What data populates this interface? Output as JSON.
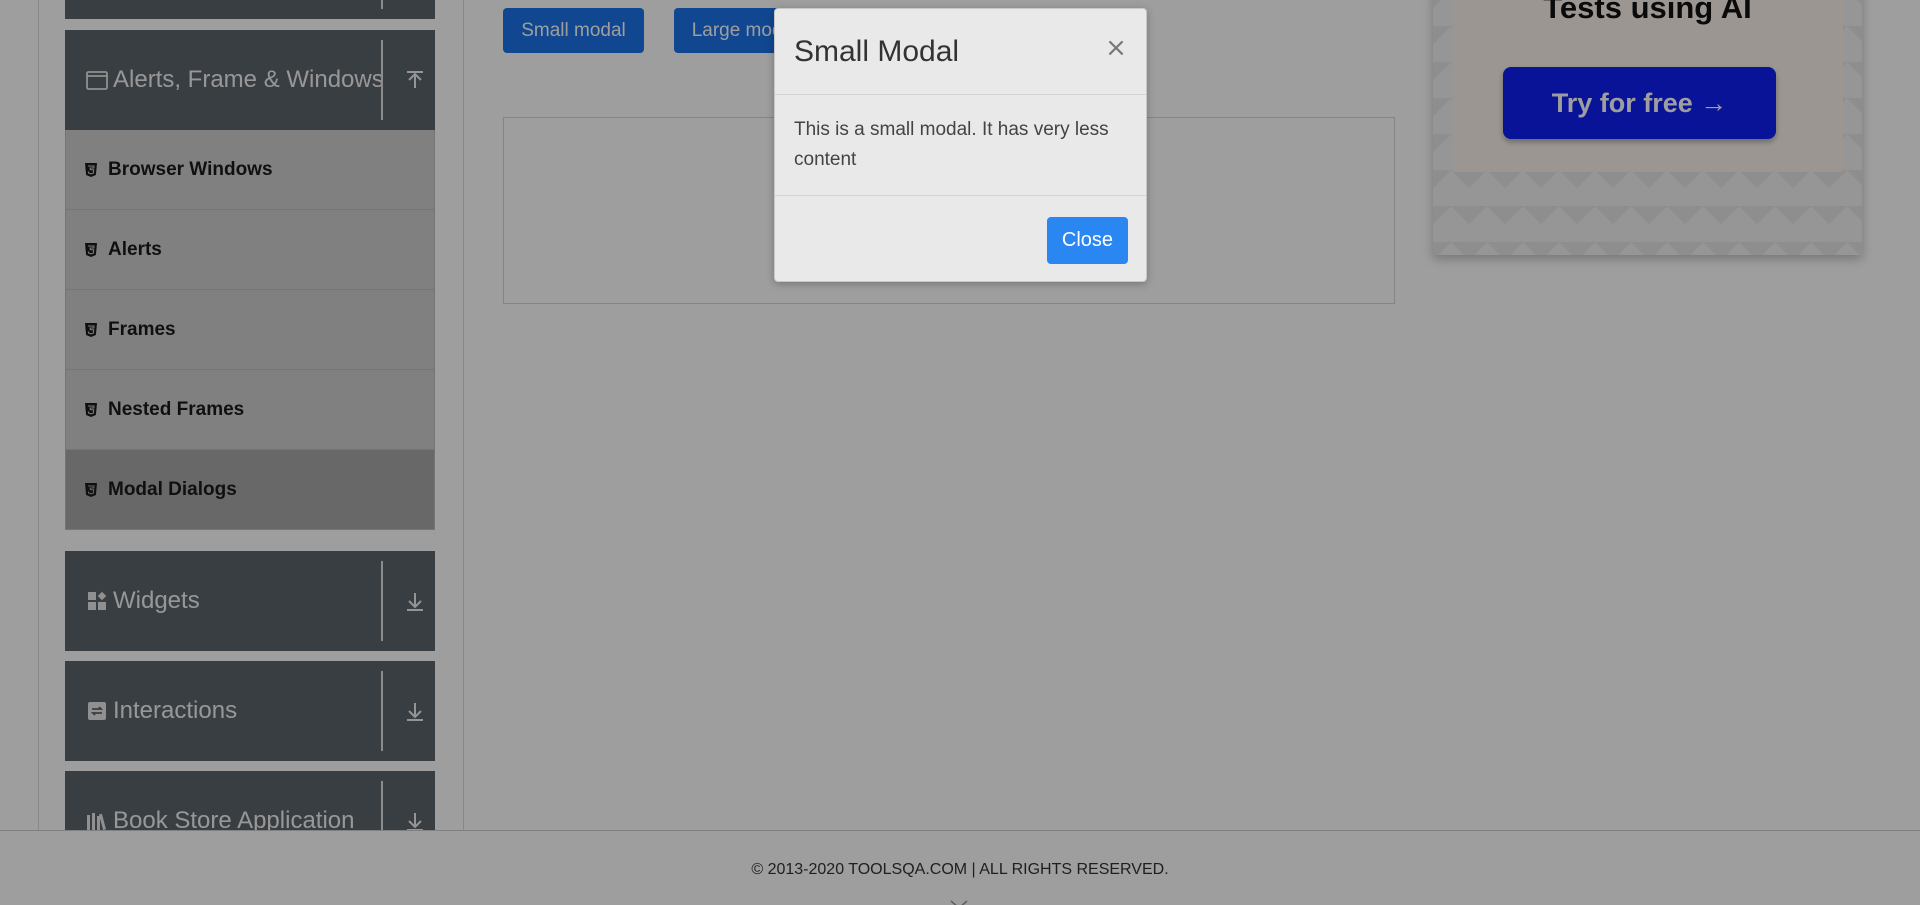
{
  "colors": {
    "primary": "#1a73e8",
    "sidebar_header": "#5c646d",
    "menu_item": "#cfcfcf",
    "menu_item_active": "#a9a9a9",
    "ad_cta": "#0f1ff5",
    "overlay": "rgba(0,0,0,0.38)"
  },
  "sidebar": {
    "groups": [
      {
        "label": "Alerts, Frame & Windows",
        "icon": "window-icon",
        "expanded": true
      },
      {
        "label": "Widgets",
        "icon": "widgets-icon",
        "expanded": false
      },
      {
        "label": "Interactions",
        "icon": "interactions-icon",
        "expanded": false
      },
      {
        "label": "Book Store Application",
        "icon": "book-store-icon",
        "expanded": false
      }
    ],
    "items": [
      {
        "label": "Browser Windows",
        "icon": "html5-icon",
        "active": false
      },
      {
        "label": "Alerts",
        "icon": "html5-icon",
        "active": false
      },
      {
        "label": "Frames",
        "icon": "html5-icon",
        "active": false
      },
      {
        "label": "Nested Frames",
        "icon": "html5-icon",
        "active": false
      },
      {
        "label": "Modal Dialogs",
        "icon": "html5-icon",
        "active": true
      }
    ]
  },
  "main": {
    "small_modal_button": "Small modal",
    "large_modal_button": "Large modal"
  },
  "ad": {
    "headline": "Tests using AI",
    "cta": "Try for free →"
  },
  "modal": {
    "title": "Small Modal",
    "close_symbol": "×",
    "body": "This is a small modal. It has very less content",
    "close_button": "Close"
  },
  "footer": {
    "copyright": "© 2013-2020 TOOLSQA.COM | ALL RIGHTS RESERVED."
  }
}
